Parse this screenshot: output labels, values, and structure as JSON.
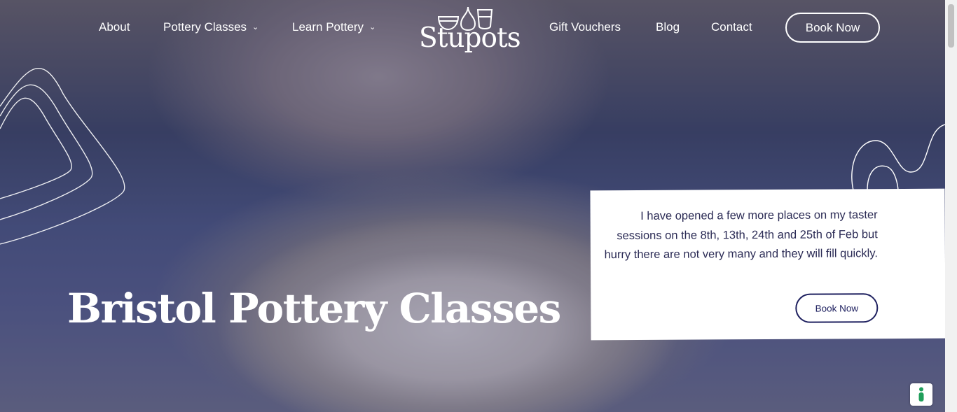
{
  "nav": {
    "about": "About",
    "pottery_classes": "Pottery Classes",
    "learn_pottery": "Learn Pottery",
    "gift_vouchers": "Gift Vouchers",
    "blog": "Blog",
    "contact": "Contact",
    "book_now": "Book Now",
    "chevron_icon": "chevron-down-icon"
  },
  "logo": {
    "text": "Stupots"
  },
  "hero": {
    "title": "Bristol Pottery Classes"
  },
  "notice": {
    "message": "I have opened a few more places on my taster sessions on the 8th, 13th, 24th and 25th of Feb but hurry there are not very many and they will fill quickly.",
    "button": "Book Now"
  },
  "accessibility": {
    "icon": "accessibility-icon"
  },
  "colors": {
    "brand_navy": "#1f2160",
    "white": "#ffffff",
    "accessibility_green": "#1f9e5a"
  }
}
